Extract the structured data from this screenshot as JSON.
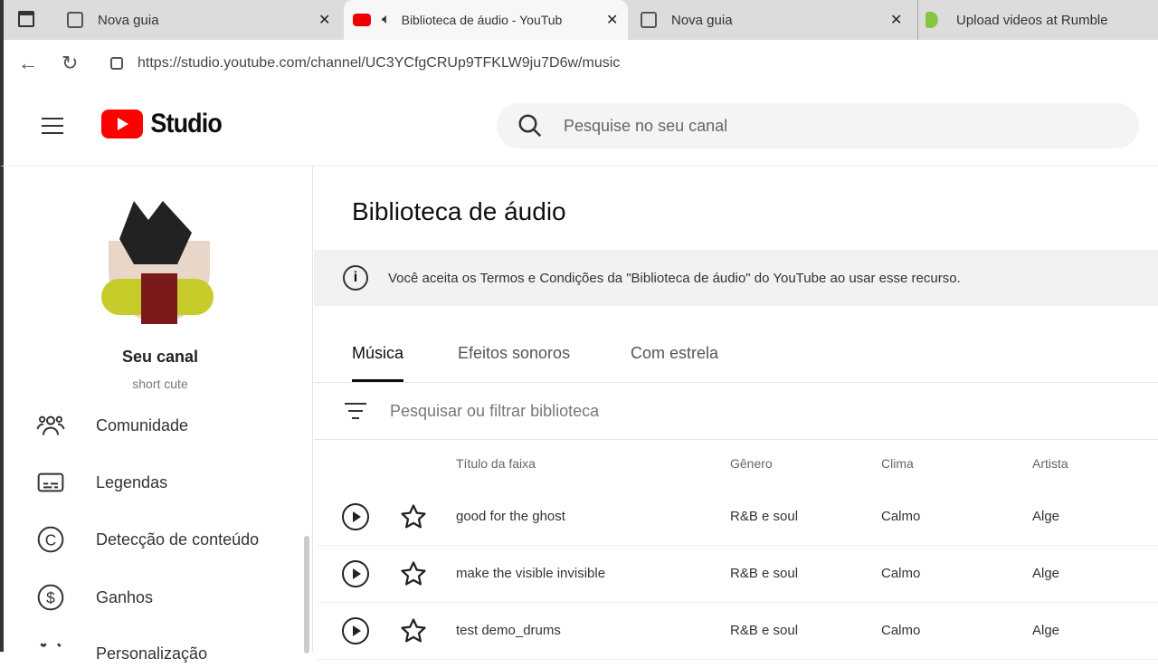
{
  "browser": {
    "tabs": [
      {
        "title": "Nova guia"
      },
      {
        "title": "Biblioteca de áudio - YouTub"
      },
      {
        "title": "Nova guia"
      },
      {
        "title": "Upload videos at Rumble"
      }
    ],
    "url": "https://studio.youtube.com/channel/UC3YCfgCRUp9TFKLW9ju7D6w/music"
  },
  "header": {
    "logo": "Studio",
    "search_placeholder": "Pesquise no seu canal"
  },
  "sidebar": {
    "channel_name": "Seu canal",
    "channel_handle": "short cute",
    "items": [
      {
        "label": "Comunidade"
      },
      {
        "label": "Legendas"
      },
      {
        "label": "Detecção de conteúdo"
      },
      {
        "label": "Ganhos"
      },
      {
        "label": "Personalização"
      }
    ]
  },
  "main": {
    "title": "Biblioteca de áudio",
    "notice": "Você aceita os Termos e Condições da \"Biblioteca de áudio\" do YouTube ao usar esse recurso.",
    "tabs": [
      {
        "label": "Música"
      },
      {
        "label": "Efeitos sonoros"
      },
      {
        "label": "Com estrela"
      }
    ],
    "filter_placeholder": "Pesquisar ou filtrar biblioteca",
    "columns": {
      "title": "Título da faixa",
      "genre": "Gênero",
      "mood": "Clima",
      "artist": "Artista"
    },
    "rows": [
      {
        "title": "good for the ghost",
        "genre": "R&B e soul",
        "mood": "Calmo",
        "artist": "Alge"
      },
      {
        "title": "make the visible invisible",
        "genre": "R&B e soul",
        "mood": "Calmo",
        "artist": "Alge"
      },
      {
        "title": "test demo_drums",
        "genre": "R&B e soul",
        "mood": "Calmo",
        "artist": "Alge"
      }
    ]
  }
}
